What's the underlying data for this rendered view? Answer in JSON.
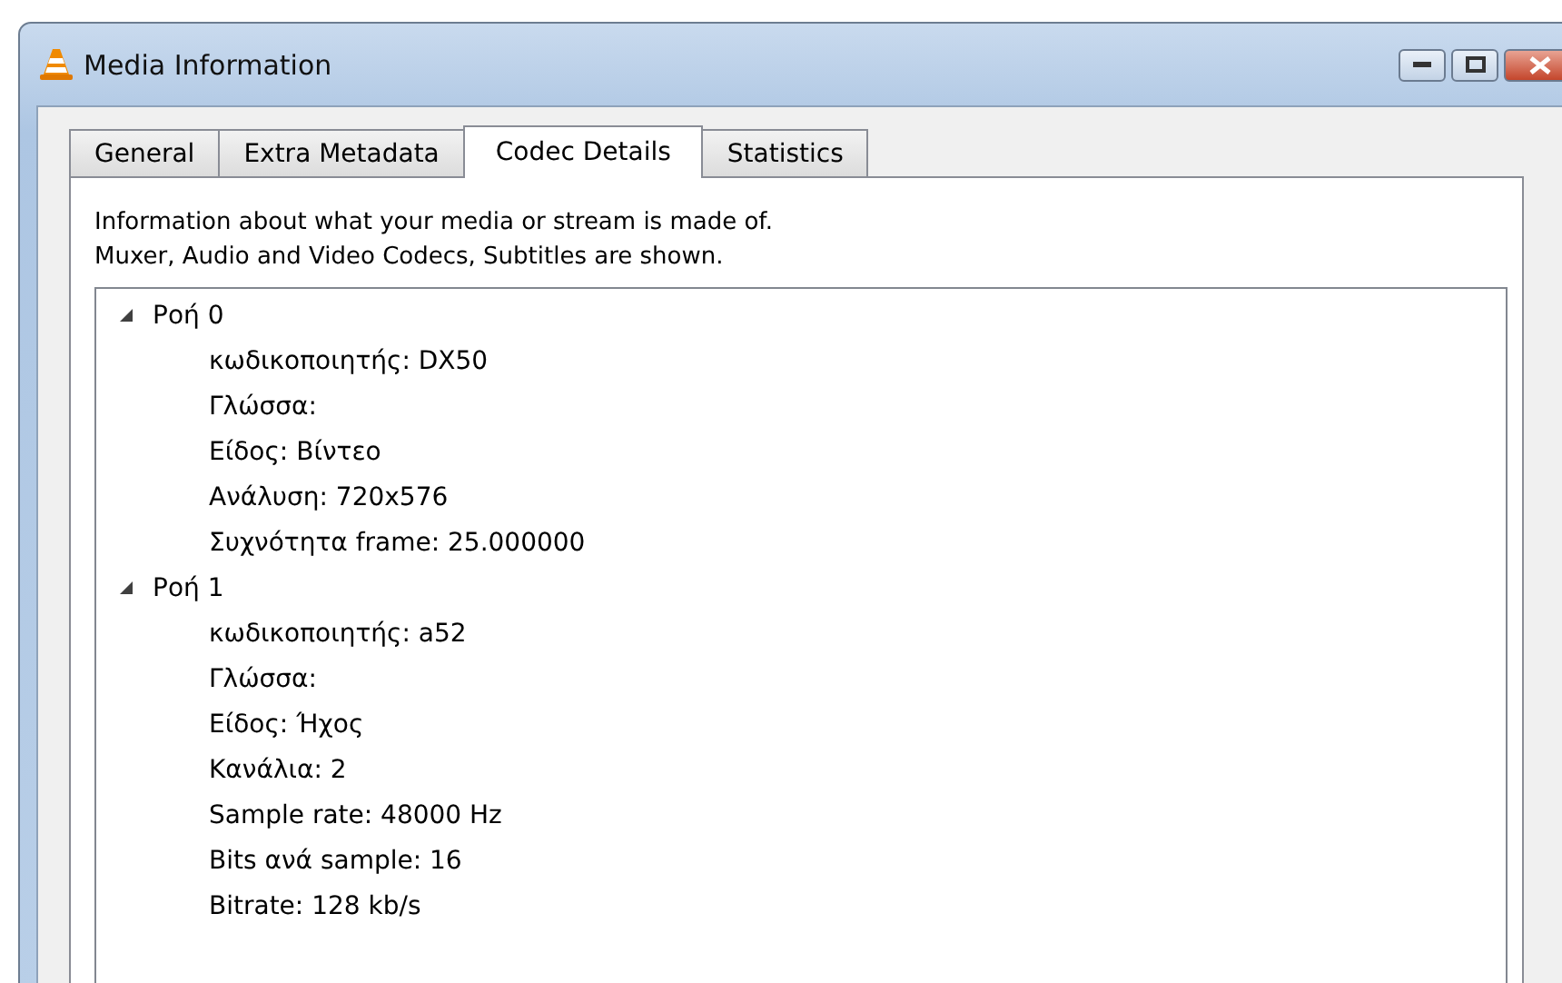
{
  "window": {
    "title": "Media Information"
  },
  "tabs": [
    {
      "label": "General",
      "selected": false
    },
    {
      "label": "Extra Metadata",
      "selected": false
    },
    {
      "label": "Codec Details",
      "selected": true
    },
    {
      "label": "Statistics",
      "selected": false
    }
  ],
  "description": [
    "Information about what your media or stream is made of.",
    "Muxer, Audio and Video Codecs, Subtitles are shown."
  ],
  "tree": {
    "items": [
      {
        "label": "Ροή 0",
        "expanded": true,
        "children": [
          {
            "label": "κωδικοποιητής: DX50"
          },
          {
            "label": "Γλώσσα:"
          },
          {
            "label": "Είδος: Βίντεο"
          },
          {
            "label": "Ανάλυση: 720x576"
          },
          {
            "label": "Συχνότητα frame: 25.000000"
          }
        ]
      },
      {
        "label": "Ροή 1",
        "expanded": true,
        "children": [
          {
            "label": "κωδικοποιητής: a52"
          },
          {
            "label": "Γλώσσα:"
          },
          {
            "label": "Είδος: Ήχος"
          },
          {
            "label": "Κανάλια: 2"
          },
          {
            "label": "Sample rate: 48000 Hz"
          },
          {
            "label": "Bits ανά sample: 16"
          },
          {
            "label": "Bitrate: 128 kb/s"
          }
        ]
      }
    ]
  }
}
